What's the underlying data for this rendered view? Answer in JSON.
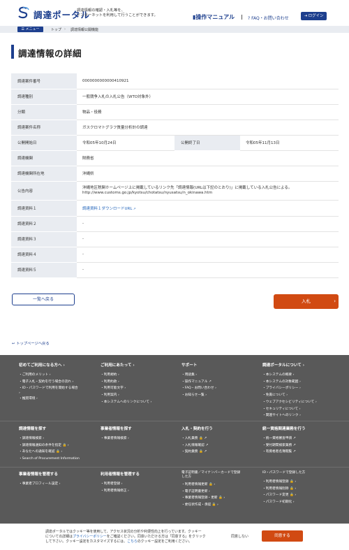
{
  "header": {
    "logo_text": "調達ポータル",
    "tagline_line1": "調達情報の確認・入札等を、",
    "tagline_line2": "インターネットを利用して行うことができます。",
    "manual_label": "操作マニュアル",
    "faq_label": "FAQ・お問い合わせ",
    "login_label": "ログイン",
    "brand_color": "#1d3f8e"
  },
  "breadcrumb": {
    "menu_label": "メニュー",
    "home_label": "トップ",
    "current_label": "調達情報公開機能"
  },
  "page": {
    "title": "調達情報の詳細"
  },
  "details": {
    "case_number_label": "調達案件番号",
    "case_number_value": "0000000000000410921",
    "type_label": "調達種別",
    "type_value": "一般競争入札の入札公告（WTO対象外）",
    "category_label": "分類",
    "category_value": "物品・役務",
    "name_label": "調達案件名称",
    "name_value": "ガスクロマトグラフ質量分析計の調達",
    "start_label": "公開開始日",
    "start_value": "令和05年10月24日",
    "end_label": "公開終了日",
    "end_value": "令和05年11月13日",
    "agency_label": "調達機関",
    "agency_value": "財務省",
    "location_label": "調達機関所在地",
    "location_value": "沖縄県",
    "notice_label": "公告内容",
    "notice_line1": "沖縄地区税関ホームページ上に掲載しているリンク先「調達情報(URLは下記のとおり)」に掲載している入札公告による。",
    "notice_line2": "http://www.customs.go.jp/kyotsu/chotatsu/nyusatsu/n_okinawa.htm",
    "doc1_label": "調達資料１",
    "doc1_value": "調達資料１ダウンロードURL",
    "doc2_label": "調達資料２",
    "doc2_value": "-",
    "doc3_label": "調達資料３",
    "doc3_value": "-",
    "doc4_label": "調達資料４",
    "doc4_value": "-",
    "doc5_label": "調達資料５",
    "doc5_value": "-"
  },
  "actions": {
    "back_label": "一覧へ戻る",
    "apply_label": "入札",
    "to_top_label": "トップページへ戻る",
    "accent_color": "#d14a12"
  },
  "footer": {
    "col1": {
      "heading": "初めてご利用になる方へ",
      "items": [
        "ご利用のメリット",
        "電子入札・契約を行う場合の流れ",
        "ID・パスワードで利用を開始する場合",
        "推奨環境"
      ]
    },
    "col2": {
      "heading": "ご利用にあたって",
      "items": [
        "利用規約",
        "利用約款",
        "利用可能文字",
        "利用案内",
        "本システムへのリンクについて"
      ]
    },
    "col3": {
      "heading": "サポート",
      "items": [
        "用語集",
        "操作マニュアル",
        "FAQ・お問い合わせ",
        "お知らせ一覧"
      ]
    },
    "col4": {
      "heading": "調達ポータルについて",
      "items": [
        "本システムの概要",
        "本システムの対象範囲",
        "プライバシーポリシー",
        "免責について",
        "ウェブアクセシビリティについて",
        "セキュリティについて",
        "関連サイトへのリンク"
      ]
    },
    "sec2_col1": {
      "heading": "調達情報を探す",
      "items": [
        "調達情報検索",
        "調達情報通知の条件を指定",
        "あなたへの通知を確認",
        "Search of Procurement Information"
      ]
    },
    "sec2_col2": {
      "heading": "事業者情報を探す",
      "items": [
        "事業者情報検索"
      ]
    },
    "sec2_col3": {
      "heading": "入札・契約を行う",
      "items": [
        "入札業務",
        "入札情報確認",
        "契約業務"
      ]
    },
    "sec2_col4": {
      "heading": "統一資格関連業務を行う",
      "items": [
        "統一資格審査申請",
        "受付期間検索業務",
        "有資格者名簿閲覧"
      ]
    },
    "sec3_col1": {
      "heading": "事業者情報を管理する",
      "items": [
        "事業者プロフィール設定"
      ]
    },
    "sec3_col2": {
      "heading": "利用者情報を管理する",
      "items": [
        "利用者登録",
        "利用者情報修正"
      ]
    },
    "sec3_col3": {
      "heading_line1": "電子証明書／マイナンバーカードで登録",
      "heading_line2": "した方",
      "items": [
        "利用者情報更新",
        "電子証明書更新",
        "事業者情報登録・更新",
        "委任状作成・承認"
      ]
    },
    "sec3_col4": {
      "heading": "ID・パスワードで登録した方",
      "items": [
        "利用者情報登録",
        "利用者情報削除",
        "パスワード変更",
        "パスワード初期化"
      ]
    }
  },
  "cookie": {
    "text_line1": "調達ポータルではクッキー等を使用して、アクセス状況の分析や利便性向上を行っています。クッキー",
    "text_line2_a": "についての詳細は",
    "privacy_link": "プライバシーポリシー",
    "text_line2_b": "をご確認ください。同意いただける方は「同意する」をクリック",
    "text_line3_a": "して下さい。クッキー設定をカスタマイズするには、",
    "here_link": "こちら",
    "text_line3_b": "のクッキー設定をご利用ください。",
    "decline_label": "同意しない",
    "accept_label": "同意する"
  }
}
